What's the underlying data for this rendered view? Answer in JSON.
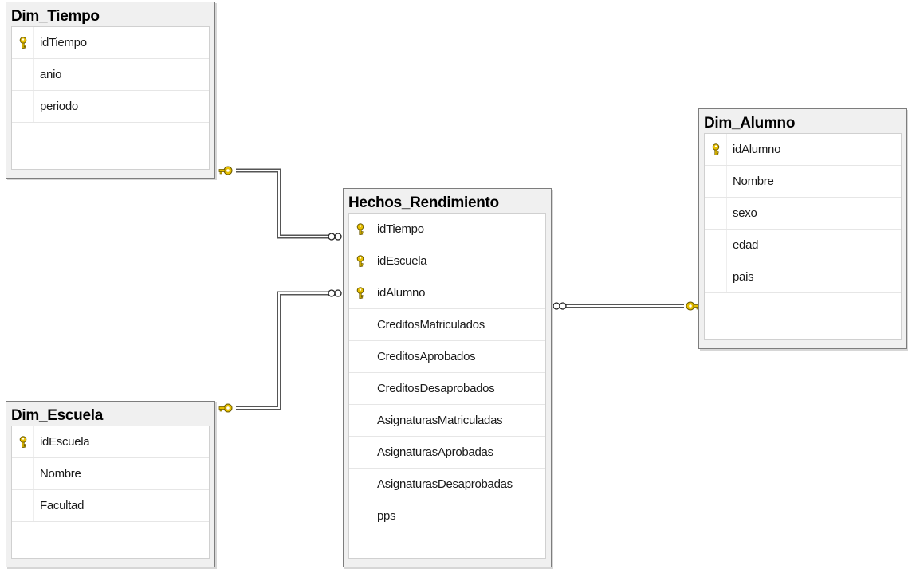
{
  "tables": {
    "dim_tiempo": {
      "title": "Dim_Tiempo",
      "columns": [
        {
          "name": "idTiempo",
          "key": true
        },
        {
          "name": "anio",
          "key": false
        },
        {
          "name": "periodo",
          "key": false
        }
      ]
    },
    "dim_escuela": {
      "title": "Dim_Escuela",
      "columns": [
        {
          "name": "idEscuela",
          "key": true
        },
        {
          "name": "Nombre",
          "key": false
        },
        {
          "name": "Facultad",
          "key": false
        }
      ]
    },
    "hechos_rendimiento": {
      "title": "Hechos_Rendimiento",
      "columns": [
        {
          "name": "idTiempo",
          "key": true
        },
        {
          "name": "idEscuela",
          "key": true
        },
        {
          "name": "idAlumno",
          "key": true
        },
        {
          "name": "CreditosMatriculados",
          "key": false
        },
        {
          "name": "CreditosAprobados",
          "key": false
        },
        {
          "name": "CreditosDesaprobados",
          "key": false
        },
        {
          "name": "AsignaturasMatriculadas",
          "key": false
        },
        {
          "name": "AsignaturasAprobadas",
          "key": false
        },
        {
          "name": "AsignaturasDesaprobadas",
          "key": false
        },
        {
          "name": "pps",
          "key": false
        }
      ]
    },
    "dim_alumno": {
      "title": "Dim_Alumno",
      "columns": [
        {
          "name": "idAlumno",
          "key": true
        },
        {
          "name": "Nombre",
          "key": false
        },
        {
          "name": "sexo",
          "key": false
        },
        {
          "name": "edad",
          "key": false
        },
        {
          "name": "pais",
          "key": false
        }
      ]
    }
  },
  "relationships": [
    {
      "one": "dim_tiempo",
      "many": "hechos_rendimiento"
    },
    {
      "one": "dim_escuela",
      "many": "hechos_rendimiento"
    },
    {
      "one": "dim_alumno",
      "many": "hechos_rendimiento"
    }
  ],
  "colors": {
    "key_icon": "#e8c000",
    "connector": "#7a7a7a",
    "border": "#7d7d7d",
    "header_bg": "#f0f0f0"
  }
}
